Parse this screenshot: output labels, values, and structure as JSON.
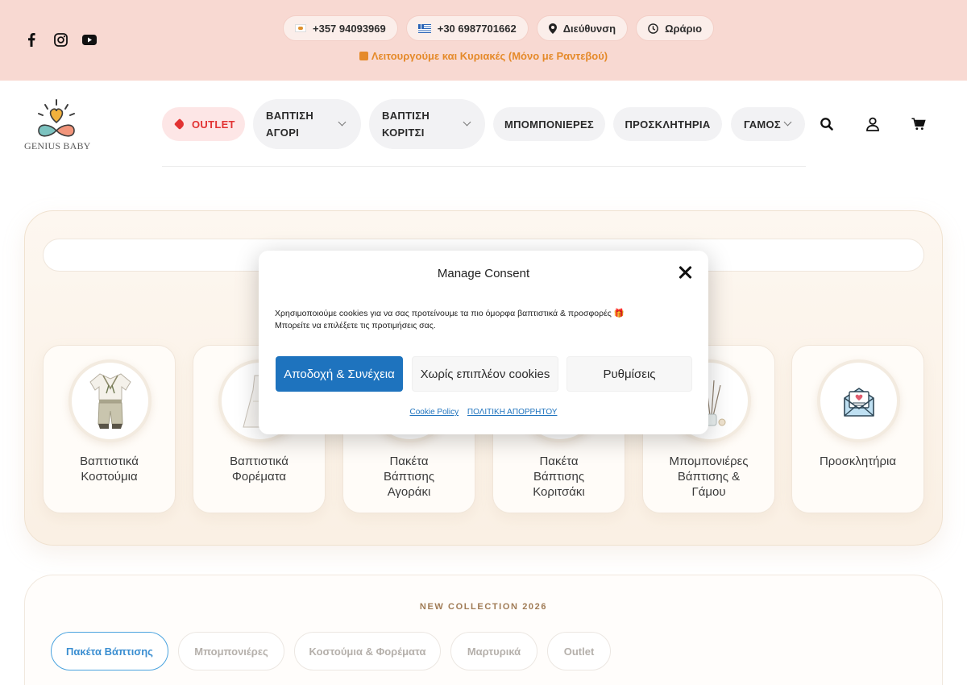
{
  "topbar": {
    "social": [
      "facebook-icon",
      "instagram-icon",
      "youtube-icon"
    ],
    "contacts": {
      "phone_cy": "+357 94093969",
      "phone_gr": "+30 6987701662",
      "address": "Διεύθυνση",
      "hours": "Ωράριο"
    },
    "notice": "Λειτουργούμε και Κυριακές (Μόνο με Ραντεβού)"
  },
  "header": {
    "logo_text": "GENIUS BABY",
    "nav": {
      "outlet": "OUTLET",
      "boy_line1": "ΒΑΠΤΙΣΗ",
      "boy_line2": "ΑΓΟΡΙ",
      "girl_line1": "ΒΑΠΤΙΣΗ",
      "girl_line2": "ΚΟΡΙΤΣΙ",
      "bombonieres": "ΜΠΟΜΠΟΝΙΕΡΕΣ",
      "invitations": "ΠΡΟΣΚΛΗΤΗΡΙΑ",
      "wedding": "ΓΑΜΟΣ"
    },
    "icons": [
      "search-icon",
      "user-icon",
      "cart-icon"
    ]
  },
  "categories": [
    {
      "line1": "Βαπτιστικά",
      "line2": "Κοστούμια",
      "line3": ""
    },
    {
      "line1": "Βαπτιστικά",
      "line2": "Φορέματα",
      "line3": ""
    },
    {
      "line1": "Πακέτα",
      "line2": "Βάπτισης",
      "line3": "Αγοράκι"
    },
    {
      "line1": "Πακέτα",
      "line2": "Βάπτισης",
      "line3": "Κοριτσάκι"
    },
    {
      "line1": "Μπομπονιέρες",
      "line2": "Βάπτισης &",
      "line3": "Γάμου"
    },
    {
      "line1": "Προσκλητήρια",
      "line2": "",
      "line3": ""
    }
  ],
  "collection": {
    "title": "NEW COLLECTION 2026",
    "tabs": [
      "Πακέτα Βάπτισης",
      "Μπομπονιέρες",
      "Κοστούμια & Φορέματα",
      "Μαρτυρικά",
      "Outlet"
    ],
    "active_tab": "Πακέτα Βάπτισης"
  },
  "consent": {
    "title": "Manage Consent",
    "text_line1": "Χρησιμοποιούμε cookies για να σας προτείνουμε τα πιο όμορφα βαπτιστικά & προσφορές 🎁",
    "text_line2": "Μπορείτε να επιλέξετε τις προτιμήσεις σας.",
    "accept": "Αποδοχή & Συνέχεια",
    "deny": "Χωρίς επιπλέον cookies",
    "settings": "Ρυθμίσεις",
    "cookie_policy": "Cookie Policy",
    "privacy_policy": "ΠΟΛΙΤΙΚΗ ΑΠΟΡΡΗΤΟΥ",
    "accent_color": "#1e73be"
  }
}
